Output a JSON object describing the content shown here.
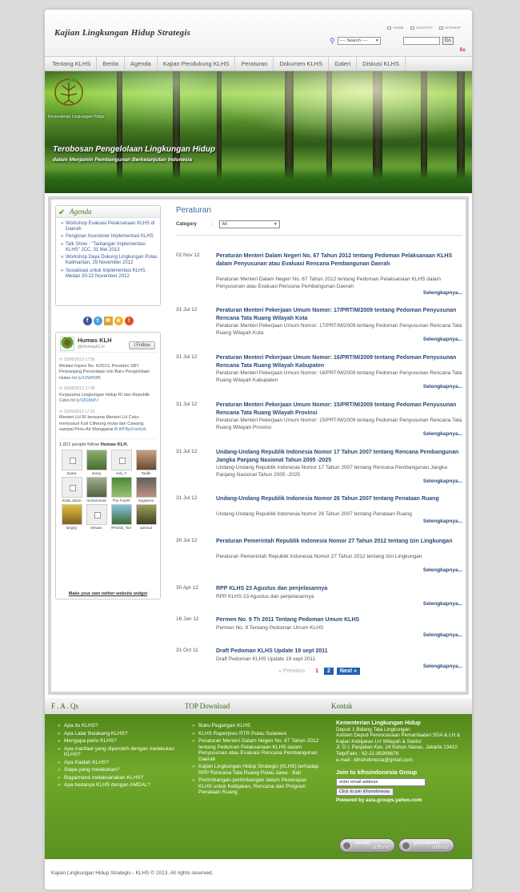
{
  "header": {
    "site_title": "Kajian Lingkungan Hidup Strategis",
    "links": [
      "HOME",
      "CONTACT",
      "SITEMAP"
    ],
    "search_select": "---- Search ----",
    "go_label": "Go",
    "be_label": "Be"
  },
  "nav": [
    "Tentang KLHS",
    "Berita",
    "Agenda",
    "Kajian Pendukung KLHS",
    "Peraturan",
    "Dokumen KLHS",
    "Galeri",
    "Diskusi KLHS"
  ],
  "banner": {
    "org": "Kementerian Lingkungan Hidup",
    "tagline1": "Terobosan Pengelolaan Lingkungan Hidup",
    "tagline2": "dalam Menjamin Pembangunan Berkelanjutan Indonesia"
  },
  "agenda": {
    "title": "Agenda",
    "items": [
      "Workshop Evaluasi Pelaksanaan KLHS di Daerah",
      "Pengisian Kuesioner Implementasi KLHS",
      "Talk Show : \"Tantangan Implementasi KLHS\" JCC, 31 Mei 2013",
      "Workshop Daya Dukung Lingkungan Pulau Kalimantan, 29 November 2012",
      "Sosialisasi untuk Implementasi KLHS, Medan 20-22 November 2012"
    ]
  },
  "twitter": {
    "name": "Humas KLH",
    "handle": "@HumasKLH",
    "follow": "Follow",
    "tweets": [
      {
        "time": "15/06/2013 17:56",
        "text": "Melalui Inpres No. 6/2013, Presiden SBY Perpanjang Penundaan Izin Baru Pengelolaan Hutan",
        "link": "bit.ly/10WR9f5"
      },
      {
        "time": "15/06/2013 17:39",
        "text": "Kerjasama Lingkungan Hidup RI dan Republik Ceko",
        "link": "bit.ly/1818bPJ"
      },
      {
        "time": "15/06/2013 17:31",
        "text": "Menteri LH RI bersama Menteri LH Ceko menyusuri Kali Ciliwung mulai dari Cawang sampai Pintu Air Manggarai",
        "link": "ift.tt/FBpZowSzk"
      }
    ],
    "followers_count": "1,821",
    "followers_text": "people follow",
    "followers_name": "Humas KLH.",
    "followers": [
      "Syara",
      "aning",
      "iAdi_Y",
      "Taufik",
      "Rolla Julian",
      "mohammad",
      "The Fourth",
      "Sugiarmo",
      "langky",
      "Ikhwan",
      "#Peduli_Tan",
      "aamaul"
    ],
    "make_widget": "Make your own twitter website widget"
  },
  "main": {
    "title": "Peraturan",
    "category_label": "Category",
    "category_value": "All",
    "more_label": "Selengkapnya...",
    "posts": [
      {
        "date": "02 Nov 12",
        "title": "Peraturan Menteri Dalam Negeri No. 67 Tahun 2012 tentang Pedoman Pelaksanaan KLHS dalam Penyusunan atau Evaluasi Rencana Pembangunan Daerah",
        "desc": "Peraturan Menteri Dalam Negeri No. 67 Tahun 2012 tentang Pedoman Pelaksanaan KLHS dalam Penyusunan atau Evaluasi Rencana Pembangunan Daerah"
      },
      {
        "date": "31 Jul 12",
        "title": "Peraturan Menteri Pekerjaan Umum Nomor: 17/PRT/M/2009 tentang Pedoman Penyusunan Rencana Tata Ruang Wilayah Kota",
        "desc": "Peraturan Menteri Pekerjaan Umum Nomor: 17/PRT/M/2009 tentang Pedoman Penyusunan Rencana Tata Ruang Wilayah Kota"
      },
      {
        "date": "31 Jul 12",
        "title": "Peraturan Menteri Pekerjaan Umum Nomor: 16/PRT/M/2009 tentang Pedoman Penyusunan Rencana Tata Ruang Wilayah Kabupaten",
        "desc": "Peraturan Menteri Pekerjaan Umum Nomor: 16/PRT/M/2009 tentang Pedoman Penyusunan Rencana Tata Ruang Wilayah Kabupaten"
      },
      {
        "date": "31 Jul 12",
        "title": "Peraturan Menteri Pekerjaan Umum Nomor: 15/PRT/M/2009 tentang Pedoman Penyusunan Rencana Tata Ruang Wilayah Provinsi",
        "desc": "Peraturan Menteri Pekerjaan Umum Nomor: 15/PRT/M/2009 tentang Pedoman Penyusunan Rencana Tata Ruang Wilayah Provinsi"
      },
      {
        "date": "31 Jul 12",
        "title": "Undang-Undang Republik Indonesia Nomor 17 Tahun 2007 tentang Rencana Pembangunan Jangka Panjang Nasional Tahun 2005 -2025",
        "desc": "Undang-Undang Republik Indonesia Nomor 17 Tahun 2007 tentang Rencana Pembangunan Jangka Panjang Nasional Tahun 2005 -2025"
      },
      {
        "date": "31 Jul 12",
        "title": "Undang-Undang Republik Indonesia Nomor 26 Tahun 2007 tentang Penataan Ruang",
        "desc": "Undang-Undang Republik Indonesia Nomor 26 Tahun 2007 tentang Penataan Ruang"
      },
      {
        "date": "30 Jul 12",
        "title": "Peraturan Pemerintah Republik Indonesia Nomor 27 Tahun 2012 tentang Izin Lingkungan",
        "desc": "Peraturan Pemerintah Republik Indonesia Nomor 27 Tahun 2012 tentang Izin Lingkungan"
      },
      {
        "date": "30 Apr 12",
        "title": "RPP KLHS 23 Agustus dan penjelasannya",
        "desc": "RPP KLHS 23 Agustus dan penjelasannya"
      },
      {
        "date": "16 Jan 12",
        "title": "Permen No. 9 Th 2011 Tentang Pedoman Umum KLHS",
        "desc": "Permen No. 9 Tentang Pedoman Umum KLHS"
      },
      {
        "date": "31 Oct 11",
        "title": "Draft Pedoman KLHS Update 19 sept 2011",
        "desc": "Draft Pedoman KLHS Update 19 sept 2011"
      }
    ],
    "pager": {
      "prev": "« Previous",
      "current": "1",
      "page2": "2",
      "next": "Next »"
    }
  },
  "footer": {
    "faq_title": "F . A . Qs",
    "faq": [
      "Apa itu KLHS?",
      "Apa Latar Belakang KLHS?",
      "Mengapa perlu KLHS?",
      "Apa manfaat yang diperoleh dengan melakukan KLHS?",
      "Apa Kaidah KLHS?",
      "Siapa yang melakukan?",
      "Bagaimana melaksanakan KLHS?",
      "Apa bedanya KLHS dengan AMDAL?"
    ],
    "top_title": "TOP Download",
    "top": [
      "Buku Pegangan KLHS",
      "KLHS Raperpres RTR Pulau Sulawesi",
      "Peraturan Menteri Dalam Negeri No. 67 Tahun 2012 tentang Pedoman Pelaksanaan KLHS dalam Penyusunan atau Evaluasi Rencana Pembangunan Daerah",
      "Kajian Lingkungan Hidup Strategis (KLHS) terhadap RPP Rencana Tata Ruang Pulau Jawa - Bali",
      "Pertimbangan-pertimbangan dalam Penerapan KLHS untuk Kebijakan, Rencana dan Program Penataan Ruang"
    ],
    "kontak_title": "Kontak",
    "kontak_org": "Kementerian Lingkungan Hidup",
    "kontak_lines": [
      "Deputi 1 Bidang Tata Lingkungan",
      "Asisten Deputi Perencanaan Pemanfaatan SDA & LH & Kajian Kebijakan LH Wilayah & Sektor",
      "Jl. D.I. Panjaitan Kav. 24 Kebun Nanas, Jakarta 13410",
      "Telp/Faks : 62-21-85906676",
      "e-mail : klhsindonesia@gmail.com"
    ],
    "join_title": "Join to klhsindonesia Group",
    "join_placeholder": "enter email address",
    "join_button": "Click to join klhsindonesia",
    "powered": "Powered by asia.groups.yahoo.com",
    "status1": "hapradg",
    "status2": "gk.kanakanera",
    "offline": "offline",
    "copyright": "Kajian Lingkungan Hidup Strategis - KLHS © 2013. All rights reserved."
  },
  "colors": {
    "accent": "#2a4a7a",
    "green": "#4b7a17",
    "link": "#3a5a9a"
  }
}
